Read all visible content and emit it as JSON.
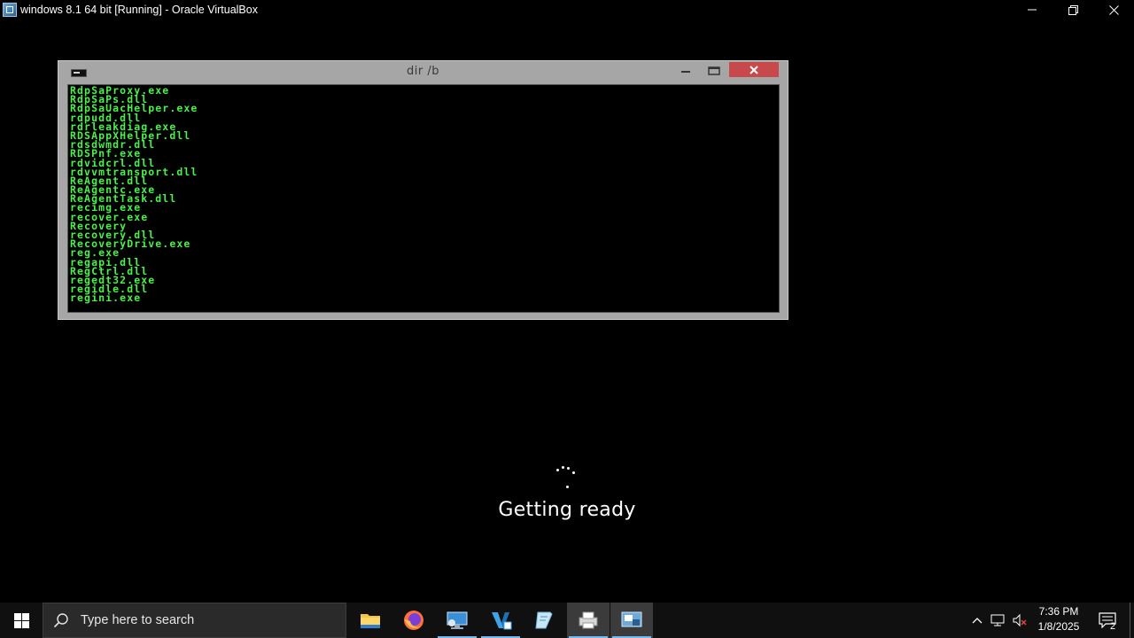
{
  "host": {
    "title": "windows 8.1 64 bit [Running] - Oracle VirtualBox",
    "app_icon": "virtualbox-icon"
  },
  "console": {
    "title": "dir /b",
    "lines": [
      "RdpSaProxy.exe",
      "RdpSaPs.dll",
      "RdpSaUacHelper.exe",
      "rdpudd.dll",
      "rdrleakdiag.exe",
      "RDSAppXHelper.dll",
      "rdsdwmdr.dll",
      "RDSPnf.exe",
      "rdvidcrl.dll",
      "rdvvmtransport.dll",
      "ReAgent.dll",
      "ReAgentc.exe",
      "ReAgentTask.dll",
      "recimg.exe",
      "recover.exe",
      "Recovery",
      "recovery.dll",
      "RecoveryDrive.exe",
      "reg.exe",
      "regapi.dll",
      "RegCtrl.dll",
      "regedt32.exe",
      "regidle.dll",
      "regini.exe"
    ],
    "text_color": "#4cf04c",
    "close_color": "#c8494b"
  },
  "status": {
    "message": "Getting ready"
  },
  "taskbar": {
    "search_placeholder": "Type here to search",
    "apps": [
      {
        "name": "file-explorer-icon"
      },
      {
        "name": "firefox-icon"
      },
      {
        "name": "remote-desktop-icon"
      },
      {
        "name": "visual-studio-code-icon"
      },
      {
        "name": "notepad-icon"
      },
      {
        "name": "printer-icon"
      },
      {
        "name": "virtualbox-icon"
      }
    ],
    "clock": {
      "time": "7:36 PM",
      "date": "1/8/2025"
    },
    "notifications_count": "2"
  }
}
